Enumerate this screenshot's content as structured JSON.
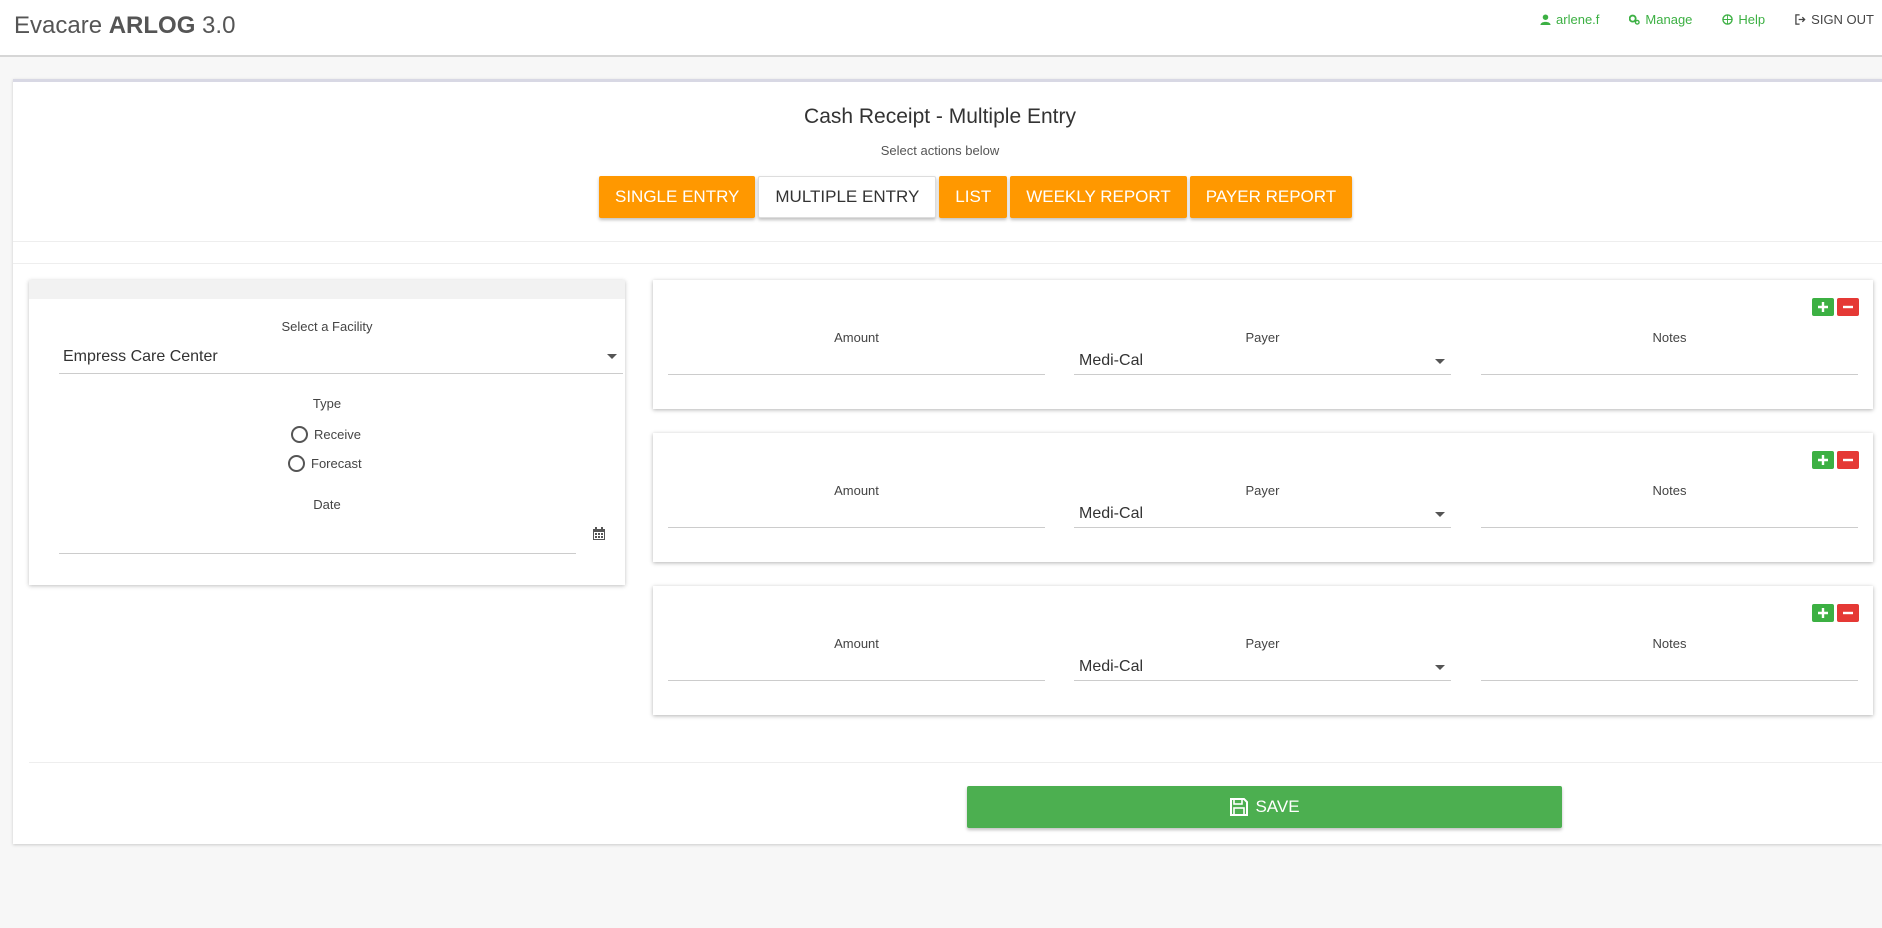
{
  "app": {
    "name_prefix": "Evacare ",
    "name_bold": "ARLOG",
    "version": " 3.0"
  },
  "topnav": {
    "user": "arlene.f",
    "manage": "Manage",
    "help": "Help",
    "signout": "SIGN OUT"
  },
  "page": {
    "title": "Cash Receipt - Multiple Entry",
    "subtitle": "Select actions below"
  },
  "actions": [
    {
      "label": "SINGLE ENTRY",
      "active": false
    },
    {
      "label": "MULTIPLE ENTRY",
      "active": true
    },
    {
      "label": "LIST",
      "active": false
    },
    {
      "label": "WEEKLY REPORT",
      "active": false
    },
    {
      "label": "PAYER REPORT",
      "active": false
    }
  ],
  "form": {
    "facility_label": "Select a Facility",
    "facility_value": "Empress Care Center",
    "type_label": "Type",
    "type_options": [
      "Receive",
      "Forecast"
    ],
    "date_label": "Date",
    "date_value": ""
  },
  "entries": [
    {
      "amount_label": "Amount",
      "amount": "",
      "payer_label": "Payer",
      "payer": "Medi-Cal",
      "notes_label": "Notes",
      "notes": ""
    },
    {
      "amount_label": "Amount",
      "amount": "",
      "payer_label": "Payer",
      "payer": "Medi-Cal",
      "notes_label": "Notes",
      "notes": ""
    },
    {
      "amount_label": "Amount",
      "amount": "",
      "payer_label": "Payer",
      "payer": "Medi-Cal",
      "notes_label": "Notes",
      "notes": ""
    }
  ],
  "save_label": "SAVE",
  "colors": {
    "orange": "#ff9800",
    "green": "#4caf50",
    "red": "#e53935",
    "nav_green": "#3cb043"
  }
}
